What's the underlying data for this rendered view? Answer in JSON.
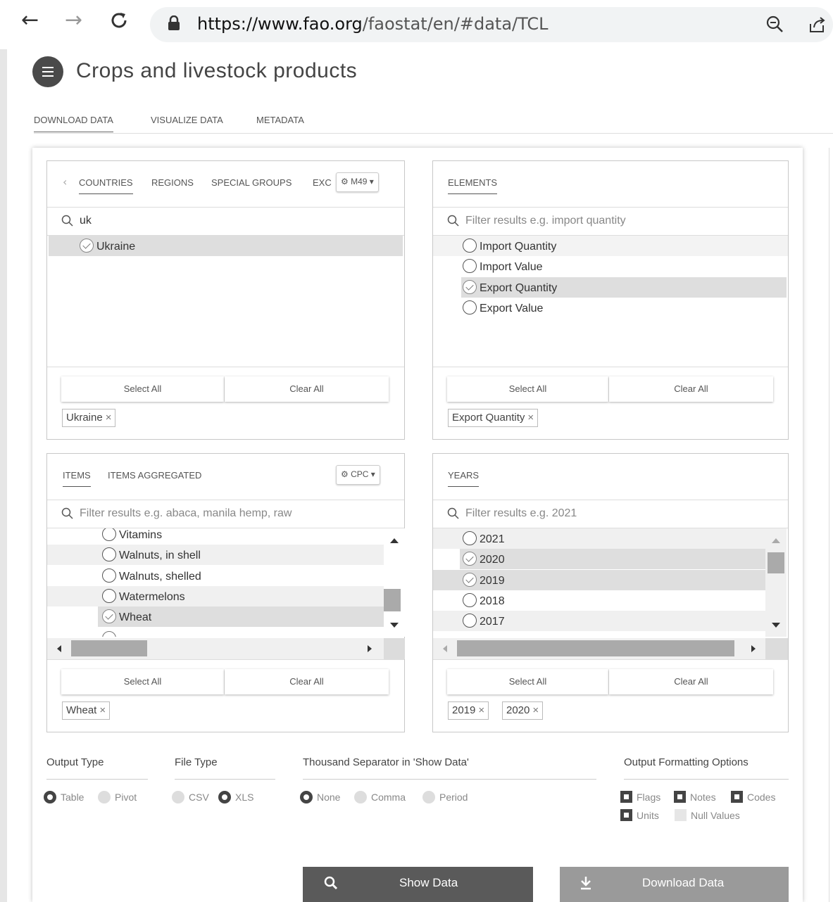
{
  "browser": {
    "back_icon": "arrow-left-icon",
    "forward_icon": "arrow-right-icon",
    "reload_icon": "reload-icon",
    "url_host": "https://www.fao.org",
    "url_path": "/faostat/en/#data/TCL"
  },
  "page": {
    "title": "Crops and livestock products",
    "tabs": [
      "DOWNLOAD DATA",
      "VISUALIZE DATA",
      "METADATA"
    ]
  },
  "countries": {
    "tabs": [
      "COUNTRIES",
      "REGIONS",
      "SPECIAL GROUPS",
      "EXC"
    ],
    "code_button": "M49",
    "search_value": "uk",
    "items": [
      {
        "label": "Ukraine",
        "checked": true
      }
    ],
    "select_all": "Select All",
    "clear_all": "Clear All",
    "chips": [
      "Ukraine"
    ]
  },
  "elements": {
    "tabs": [
      "ELEMENTS"
    ],
    "search_placeholder": "Filter results  e.g. import quantity",
    "items": [
      {
        "label": "Import Quantity",
        "checked": false
      },
      {
        "label": "Import Value",
        "checked": false
      },
      {
        "label": "Export Quantity",
        "checked": true
      },
      {
        "label": "Export Value",
        "checked": false
      }
    ],
    "select_all": "Select All",
    "clear_all": "Clear All",
    "chips": [
      "Export Quantity"
    ]
  },
  "items": {
    "tabs": [
      "ITEMS",
      "ITEMS AGGREGATED"
    ],
    "code_button": "CPC",
    "search_placeholder": "Filter results  e.g. abaca, manila hemp, raw",
    "items": [
      {
        "label": "Vitamins",
        "checked": false
      },
      {
        "label": "Walnuts, in shell",
        "checked": false
      },
      {
        "label": "Walnuts, shelled",
        "checked": false
      },
      {
        "label": "Watermelons",
        "checked": false
      },
      {
        "label": "Wheat",
        "checked": true
      }
    ],
    "select_all": "Select All",
    "clear_all": "Clear All",
    "chips": [
      "Wheat"
    ]
  },
  "years": {
    "tabs": [
      "YEARS"
    ],
    "search_placeholder": "Filter results  e.g. 2021",
    "items": [
      {
        "label": "2021",
        "checked": false
      },
      {
        "label": "2020",
        "checked": true
      },
      {
        "label": "2019",
        "checked": true
      },
      {
        "label": "2018",
        "checked": false
      },
      {
        "label": "2017",
        "checked": false
      }
    ],
    "select_all": "Select All",
    "clear_all": "Clear All",
    "chips": [
      "2019",
      "2020"
    ]
  },
  "options": {
    "output_type": {
      "label": "Output Type",
      "choices": [
        "Table",
        "Pivot"
      ],
      "selected": "Table"
    },
    "file_type": {
      "label": "File Type",
      "choices": [
        "CSV",
        "XLS"
      ],
      "selected": "XLS"
    },
    "thousand_sep": {
      "label": "Thousand Separator in 'Show Data'",
      "choices": [
        "None",
        "Comma",
        "Period"
      ],
      "selected": "None"
    },
    "formatting": {
      "label": "Output Formatting Options",
      "flags": "Flags",
      "notes": "Notes",
      "codes": "Codes",
      "units": "Units",
      "null_values": "Null Values"
    }
  },
  "actions": {
    "show_data": "Show Data",
    "download_data": "Download Data"
  },
  "colors": {
    "show_button": "#5a5a5a",
    "download_button": "#9a9a9a",
    "selected_row": "#dedede"
  }
}
